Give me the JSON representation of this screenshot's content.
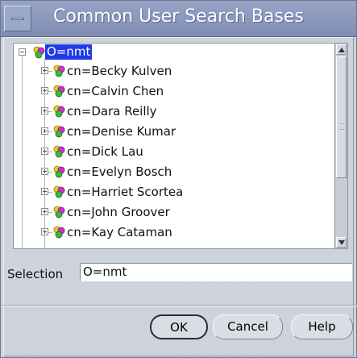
{
  "title": "Common User Search Bases",
  "tree": {
    "root": "O=nmt",
    "items": [
      "cn=Becky Kulven",
      "cn=Calvin Chen",
      "cn=Dara  Reilly",
      "cn=Denise Kumar",
      "cn=Dick Lau",
      "cn=Evelyn Bosch",
      "cn=Harriet Scortea",
      "cn=John Groover",
      "cn=Kay Cataman"
    ]
  },
  "selection": {
    "label": "Selection",
    "value": "O=nmt"
  },
  "buttons": {
    "ok": "OK",
    "cancel": "Cancel",
    "help": "Help"
  },
  "colors": {
    "titlebar": "#8795bc",
    "selected": "#1f3ce7",
    "background": "#cfd3db"
  },
  "icons": {
    "title_menu": "system-menu-icon",
    "tree_node": "organization-node-icon"
  }
}
